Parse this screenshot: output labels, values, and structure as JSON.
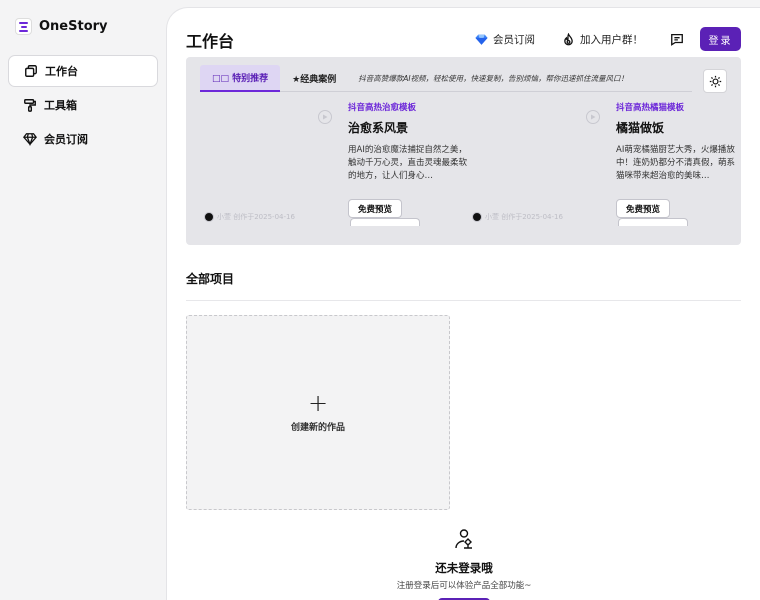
{
  "brand": {
    "name": "OneStory",
    "logo_icon": "onestory-logo-icon",
    "accent": "#5b21b6"
  },
  "sidebar": {
    "items": [
      {
        "label": "工作台",
        "icon": "workspace-icon",
        "active": true
      },
      {
        "label": "工具箱",
        "icon": "paint-roller-icon",
        "active": false
      },
      {
        "label": "会员订阅",
        "icon": "diamond-icon",
        "active": false
      }
    ]
  },
  "header": {
    "title": "工作台",
    "membership_label": "会员订阅",
    "join_group_label": "加入用户群！",
    "message_icon": "message-icon",
    "login_label": "登录"
  },
  "banner": {
    "tabs": [
      {
        "label": "□□ 特别推荐",
        "active": true
      },
      {
        "label": "★经典案例",
        "active": false
      }
    ],
    "description": "抖音高赞爆款AI视频，轻松使用，快速复制，告别烦恼，帮你迅速抓住流量风口！",
    "theme_toggle_icon": "lightbulb-icon",
    "cards": [
      {
        "tag": "抖音高热治愈模板",
        "title": "治愈系风景",
        "description": "用AI的治愈魔法捕捉自然之美，触动千万心灵，直击灵魂最柔软的地方，让人们身心…",
        "author": "小萱 创作于2025-04-16",
        "preview_label": "免费预览"
      },
      {
        "tag": "抖音高热橘猫模板",
        "title": "橘猫做饭",
        "description": "AI萌宠橘猫厨艺大秀，火爆播放中！连奶奶都分不清真假，萌系猫咪带来超治愈的美味…",
        "author": "小萱 创作于2025-04-16",
        "preview_label": "免费预览"
      }
    ]
  },
  "projects": {
    "title": "全部项目",
    "create_label": "创建新的作品"
  },
  "empty_state": {
    "icon": "login-person-icon",
    "title": "还未登录哦",
    "subtitle": "注册登录后可以体验产品全部功能~"
  }
}
